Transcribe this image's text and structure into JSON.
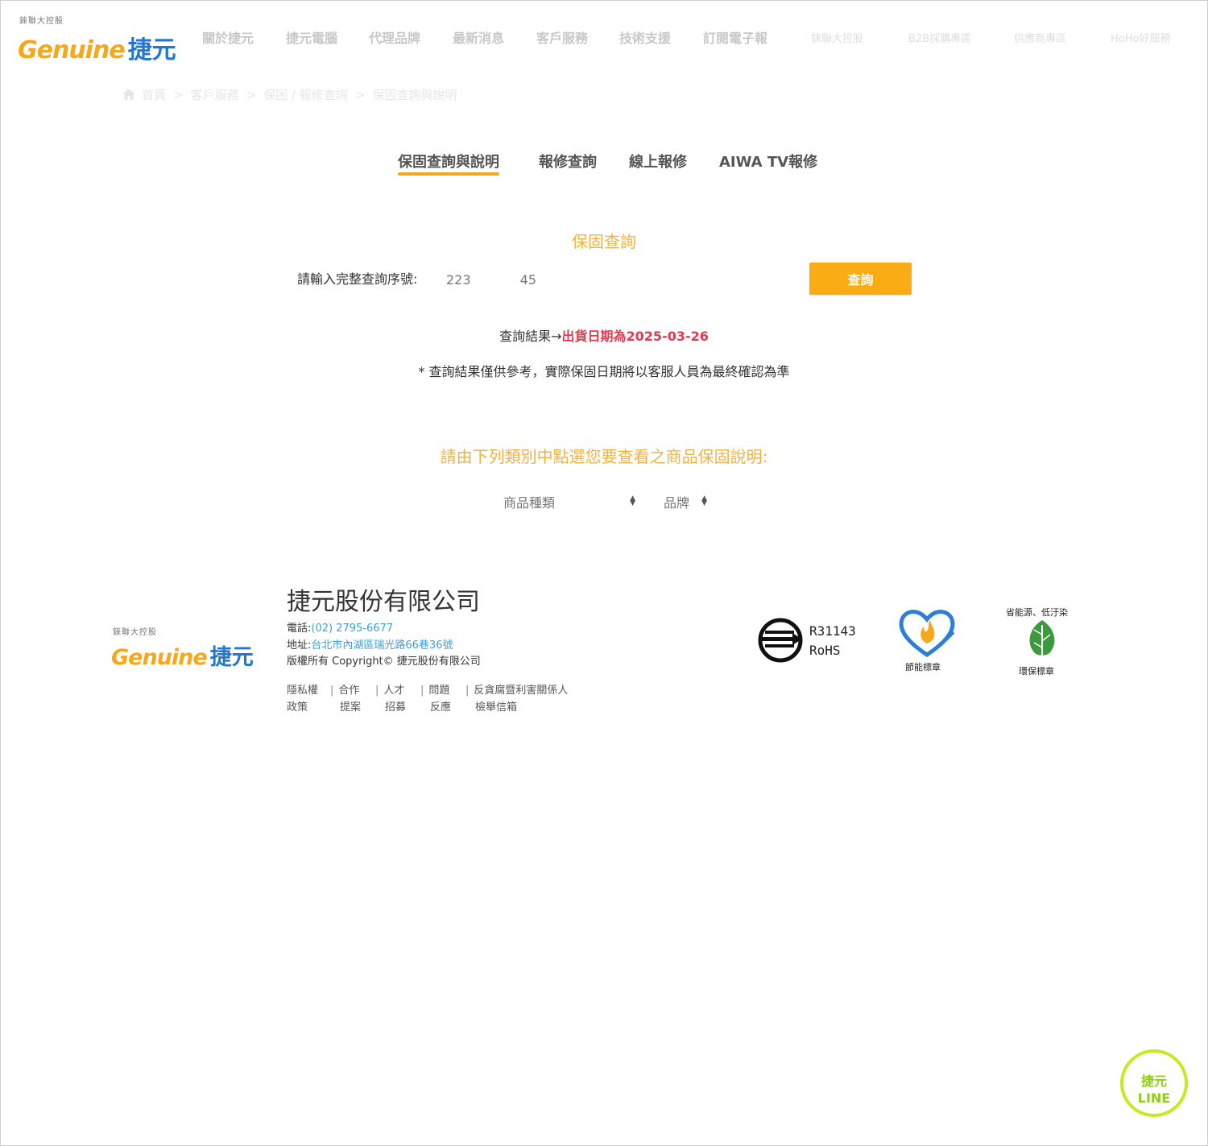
{
  "header": {
    "logo_sub": "錸聯大控股",
    "logo_en": "Genuine",
    "logo_zh": "捷元",
    "nav": [
      "關於捷元",
      "捷元電腦",
      "代理品牌",
      "最新消息",
      "客戶服務",
      "技術支援",
      "訂閱電子報"
    ],
    "nav_secondary": [
      "錸聯大控股",
      "B2B採購專區",
      "供應商專區",
      "HoHo好服務"
    ]
  },
  "breadcrumb": [
    "首頁",
    ">",
    "客戶服務",
    ">",
    "保固 / 報修查詢",
    ">",
    "保固查詢與說明"
  ],
  "tabs": [
    "保固查詢與說明",
    "報修查詢",
    "線上報修",
    "AIWA TV報修"
  ],
  "query": {
    "title": "保固查詢",
    "label": "請輸入完整查詢序號:",
    "value": "223            45",
    "button": "查詢",
    "result_prefix": "查詢結果→",
    "result_value": "出貨日期為2025-03-26",
    "note": "* 查詢結果僅供參考，實際保固日期將以客服人員為最終確認為準"
  },
  "category": {
    "title": "請由下列類別中點選您要查看之商品保固說明:",
    "select1": "商品種類",
    "select2": "品牌"
  },
  "footer": {
    "company": "捷元股份有限公司",
    "phone_label": "電話:",
    "phone": "(02) 2795-6677",
    "address_label": "地址:",
    "address": "台北市內湖區瑞光路66巷36號",
    "copyright": "版權所有 Copyright© 捷元股份有限公司",
    "links": [
      {
        "l1": "隱私權",
        "l2": "政策"
      },
      {
        "l1": "合作",
        "l2": "提案"
      },
      {
        "l1": "人才",
        "l2": "招募"
      },
      {
        "l1": "問題",
        "l2": "反應"
      },
      {
        "l1": "反貪腐暨利害關係人",
        "l2": "檢舉信箱"
      }
    ],
    "rohs_code": "R31143",
    "rohs": "RoHS",
    "energy_label": "節能標章",
    "eco_top": "省能源、低汙染",
    "eco_label": "環保標章"
  },
  "line_badge": {
    "line1": "捷元",
    "line2": "LINE"
  },
  "colors": {
    "accent": "#f9ac13",
    "title_orange": "#f2b23c",
    "result_red": "#e23b50",
    "link_blue": "#3aa0d8",
    "brand_blue": "#1f77d0"
  }
}
